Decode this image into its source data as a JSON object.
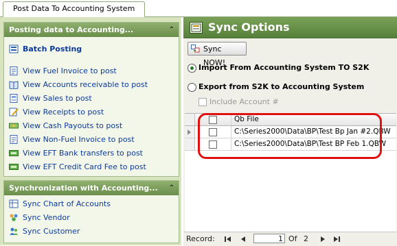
{
  "tab": {
    "label": "Post Data To Accounting System"
  },
  "posting_panel": {
    "title": "Posting data to Accounting...",
    "collapse_glyph": "⌃",
    "items": [
      {
        "label": "Batch Posting",
        "icon": "batch-posting-icon"
      },
      {
        "label": "View Fuel Invoice to post",
        "icon": "invoice-icon"
      },
      {
        "label": "View Accounts receivable to post",
        "icon": "book-icon"
      },
      {
        "label": "View Sales to post",
        "icon": "sales-icon"
      },
      {
        "label": "View Receipts to post",
        "icon": "receipt-icon"
      },
      {
        "label": "View Cash Payouts to post",
        "icon": "cash-icon"
      },
      {
        "label": "View Non-Fuel Invoice to post",
        "icon": "invoice-icon"
      },
      {
        "label": "View EFT Bank transfers to post",
        "icon": "eft-icon"
      },
      {
        "label": "View EFT Credit Card Fee to post",
        "icon": "eft-icon"
      }
    ]
  },
  "sync_panel": {
    "title": "Synchronization with Accounting...",
    "collapse_glyph": "⌃",
    "items": [
      {
        "label": "Sync Chart of Accounts",
        "icon": "chart-of-accounts-icon"
      },
      {
        "label": "Sync Vendor",
        "icon": "vendor-icon"
      },
      {
        "label": "Sync Customer",
        "icon": "customer-icon"
      }
    ]
  },
  "sync_options": {
    "title": "Sync Options",
    "sync_now_label": "Sync NOW!",
    "import_label": "Import From Accounting System TO S2K",
    "export_label": "Export from S2K to Accounting System",
    "include_account_label": "Include Account #",
    "import_selected": true
  },
  "grid": {
    "column_header": "Qb File",
    "rows": [
      {
        "file": "C:\\Series2000\\Data\\BP\\Test Bp Jan #2.QBW",
        "checked": false,
        "current": true
      },
      {
        "file": "C:\\Series2000\\Data\\BP\\Test BP Feb 1.QBW",
        "checked": false,
        "current": false
      }
    ]
  },
  "navigator": {
    "record_label": "Record:",
    "current": "1",
    "of_label": "Of",
    "total": "2"
  },
  "colors": {
    "header_green": "#6b8e4b",
    "link_blue": "#0b3a9a",
    "highlight_red": "#e01010"
  }
}
